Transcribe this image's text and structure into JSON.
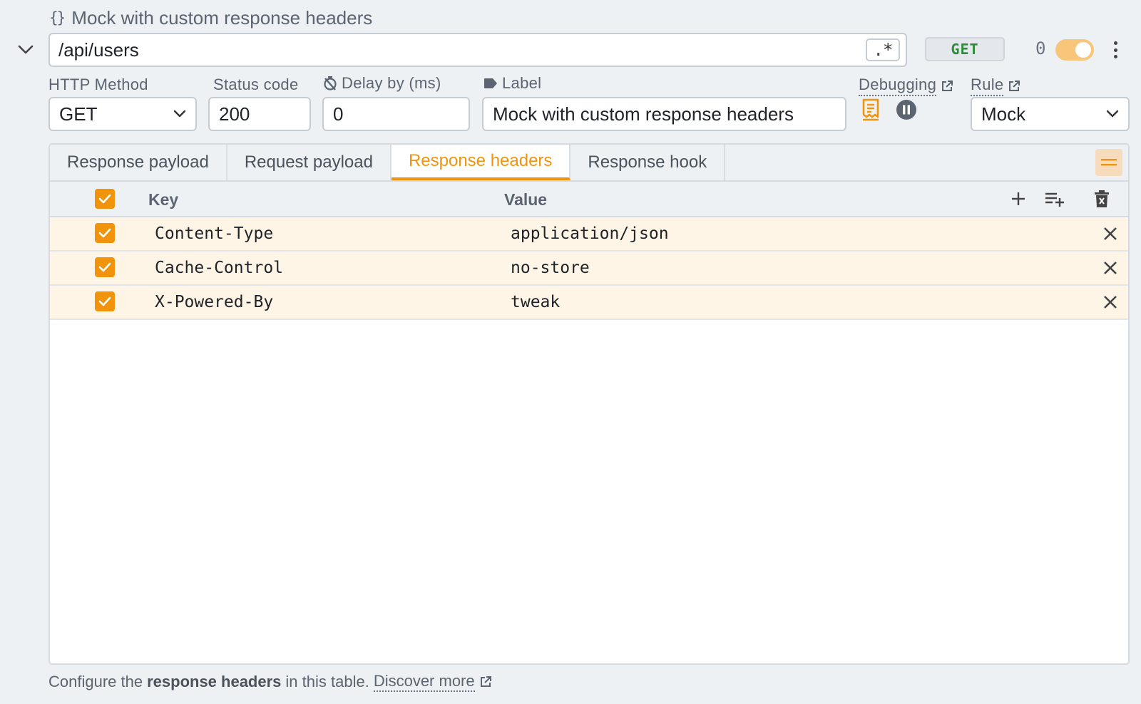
{
  "header": {
    "rule_title": "Mock with custom response headers",
    "url": "/api/users",
    "regex_label": ".*",
    "method_badge": "GET",
    "hit_count": "0",
    "enabled": true
  },
  "fields": {
    "http_method": {
      "label": "HTTP Method",
      "value": "GET"
    },
    "status_code": {
      "label": "Status code",
      "value": "200"
    },
    "delay": {
      "label": "Delay by (ms)",
      "value": "0"
    },
    "label": {
      "label": "Label",
      "value": "Mock with custom response headers"
    },
    "debugging": {
      "label": "Debugging"
    },
    "rule": {
      "label": "Rule",
      "value": "Mock"
    }
  },
  "tabs": [
    {
      "label": "Response payload",
      "active": false
    },
    {
      "label": "Request payload",
      "active": false
    },
    {
      "label": "Response headers",
      "active": true
    },
    {
      "label": "Response hook",
      "active": false
    }
  ],
  "table": {
    "headers": {
      "key": "Key",
      "value": "Value"
    },
    "rows": [
      {
        "checked": true,
        "key": "Content-Type",
        "value": "application/json"
      },
      {
        "checked": true,
        "key": "Cache-Control",
        "value": "no-store"
      },
      {
        "checked": true,
        "key": "X-Powered-By",
        "value": "tweak"
      }
    ]
  },
  "footer": {
    "prefix": "Configure the",
    "bold": "response headers",
    "suffix": "in this table.",
    "link": "Discover more"
  },
  "colors": {
    "accent": "#f2940b",
    "method_green": "#2e8b3a",
    "row_highlight": "#fff5e7"
  }
}
